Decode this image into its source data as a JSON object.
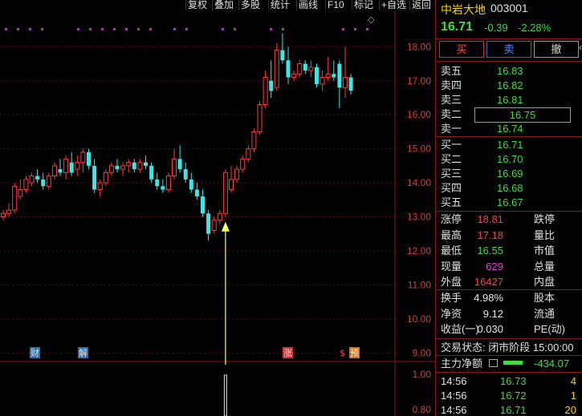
{
  "toolbar": {
    "items": [
      "复权",
      "叠加",
      "多股",
      "统计",
      "画线",
      "F10",
      "+自选",
      "标记",
      "返回"
    ]
  },
  "chart_data": {
    "type": "candlestick",
    "y_ticks": [
      "18.00",
      "17.00",
      "16.00",
      "15.00",
      "14.00",
      "13.00",
      "12.00",
      "11.00",
      "10.00",
      "9.00"
    ],
    "ylim": [
      8.9,
      18.95
    ],
    "vol_ticks": [
      "1.00",
      "0.80"
    ],
    "ohlc": [
      [
        13.0,
        13.2,
        12.9,
        13.1
      ],
      [
        13.1,
        13.4,
        13.0,
        13.2
      ],
      [
        13.2,
        14.0,
        13.1,
        13.9
      ],
      [
        13.6,
        14.1,
        13.5,
        13.8
      ],
      [
        13.8,
        14.2,
        13.7,
        14.1
      ],
      [
        14.0,
        14.3,
        13.9,
        14.2
      ],
      [
        14.2,
        14.4,
        14.0,
        14.1
      ],
      [
        14.1,
        14.3,
        13.8,
        13.9
      ],
      [
        13.9,
        14.3,
        13.8,
        14.2
      ],
      [
        14.2,
        14.6,
        14.1,
        14.5
      ],
      [
        14.4,
        14.7,
        14.2,
        14.3
      ],
      [
        14.3,
        14.8,
        14.1,
        14.7
      ],
      [
        14.6,
        14.9,
        14.2,
        14.3
      ],
      [
        14.4,
        14.8,
        14.2,
        14.6
      ],
      [
        14.6,
        15.0,
        14.3,
        14.9
      ],
      [
        14.9,
        15.0,
        14.4,
        14.5
      ],
      [
        14.5,
        14.7,
        13.7,
        13.8
      ],
      [
        13.8,
        14.1,
        13.6,
        14.0
      ],
      [
        14.0,
        14.4,
        13.9,
        14.3
      ],
      [
        14.3,
        14.6,
        14.2,
        14.5
      ],
      [
        14.5,
        14.7,
        14.3,
        14.4
      ],
      [
        14.4,
        14.6,
        14.2,
        14.5
      ],
      [
        14.5,
        14.7,
        14.3,
        14.6
      ],
      [
        14.6,
        14.7,
        14.3,
        14.4
      ],
      [
        14.4,
        14.7,
        14.3,
        14.6
      ],
      [
        14.6,
        14.8,
        14.4,
        14.5
      ],
      [
        14.5,
        14.6,
        14.0,
        14.1
      ],
      [
        14.1,
        14.3,
        13.8,
        13.9
      ],
      [
        13.9,
        14.1,
        13.7,
        13.8
      ],
      [
        13.8,
        14.3,
        13.7,
        14.2
      ],
      [
        14.2,
        15.0,
        14.1,
        14.7
      ],
      [
        14.7,
        15.1,
        14.3,
        14.4
      ],
      [
        14.4,
        14.6,
        14.0,
        14.1
      ],
      [
        14.1,
        14.3,
        13.7,
        13.8
      ],
      [
        13.8,
        14.0,
        13.5,
        13.6
      ],
      [
        13.6,
        13.8,
        13.0,
        13.1
      ],
      [
        13.1,
        13.2,
        12.3,
        12.5
      ],
      [
        12.6,
        13.0,
        12.5,
        12.9
      ],
      [
        12.9,
        13.2,
        12.8,
        13.1
      ],
      [
        13.1,
        14.4,
        13.0,
        14.3
      ],
      [
        13.8,
        14.5,
        13.7,
        14.1
      ],
      [
        14.1,
        14.5,
        14.0,
        14.4
      ],
      [
        14.4,
        14.8,
        14.3,
        14.7
      ],
      [
        14.7,
        15.1,
        14.6,
        15.0
      ],
      [
        15.0,
        15.6,
        14.9,
        15.5
      ],
      [
        15.5,
        16.4,
        15.4,
        16.3
      ],
      [
        16.3,
        17.3,
        16.2,
        17.1
      ],
      [
        17.0,
        17.6,
        16.5,
        16.7
      ],
      [
        16.8,
        18.1,
        16.7,
        17.9
      ],
      [
        17.9,
        18.4,
        17.5,
        17.6
      ],
      [
        17.6,
        18.0,
        16.9,
        17.1
      ],
      [
        17.1,
        17.3,
        17.0,
        17.2
      ],
      [
        17.2,
        17.6,
        17.1,
        17.5
      ],
      [
        17.5,
        17.6,
        17.2,
        17.3
      ],
      [
        17.3,
        17.6,
        17.1,
        17.4
      ],
      [
        17.4,
        17.5,
        16.8,
        16.9
      ],
      [
        16.9,
        17.3,
        16.7,
        17.1
      ],
      [
        17.1,
        17.7,
        17.0,
        17.2
      ],
      [
        17.2,
        17.6,
        17.0,
        17.1
      ],
      [
        17.5,
        17.6,
        16.2,
        16.8
      ],
      [
        16.8,
        18.0,
        16.5,
        17.1
      ],
      [
        17.1,
        17.2,
        16.6,
        16.71
      ]
    ],
    "markers": [
      "财",
      "解",
      "涨",
      "$",
      "预"
    ]
  },
  "panel": {
    "name": "中岩大地",
    "code": "003001",
    "price": "16.71",
    "change": "-0.39",
    "change_pct": "-2.28%",
    "buttons": {
      "buy": "买",
      "sell": "卖",
      "cancel": "撤"
    },
    "asks": [
      {
        "label": "卖五",
        "price": "16.83"
      },
      {
        "label": "卖四",
        "price": "16.82"
      },
      {
        "label": "卖三",
        "price": "16.81"
      },
      {
        "label": "卖二",
        "price": "16.75"
      },
      {
        "label": "卖一",
        "price": "16.74"
      }
    ],
    "bids": [
      {
        "label": "买一",
        "price": "16.71"
      },
      {
        "label": "买二",
        "price": "16.70"
      },
      {
        "label": "买三",
        "price": "16.69"
      },
      {
        "label": "买四",
        "price": "16.68"
      },
      {
        "label": "买五",
        "price": "16.67"
      }
    ],
    "stats": [
      {
        "l": "涨停",
        "v": "18.81",
        "color": "red",
        "r": "跌停"
      },
      {
        "l": "最高",
        "v": "17.18",
        "color": "red",
        "r": "量比"
      },
      {
        "l": "最低",
        "v": "16.55",
        "color": "green",
        "r": "市值"
      },
      {
        "l": "现量",
        "v": "629",
        "color": "magenta",
        "r": "总量"
      },
      {
        "l": "外盘",
        "v": "16427",
        "color": "red",
        "r": "内盘"
      }
    ],
    "stats2": [
      {
        "l": "换手",
        "v": "4.98%",
        "color": "white",
        "r": "股本"
      },
      {
        "l": "净资",
        "v": "9.12",
        "color": "white",
        "r": "流通"
      },
      {
        "l": "收益(一)",
        "v": "0.030",
        "color": "white",
        "r": "PE(动)"
      }
    ],
    "status": "交易状态: 闭市阶段 15:00:00",
    "main_label": "主力净额",
    "main_value": "-434.07",
    "ticks": [
      {
        "time": "14:56",
        "price": "16.73",
        "vol": "4"
      },
      {
        "time": "14:56",
        "price": "16.72",
        "vol": "1"
      },
      {
        "time": "14:56",
        "price": "16.71",
        "vol": "20"
      }
    ]
  }
}
